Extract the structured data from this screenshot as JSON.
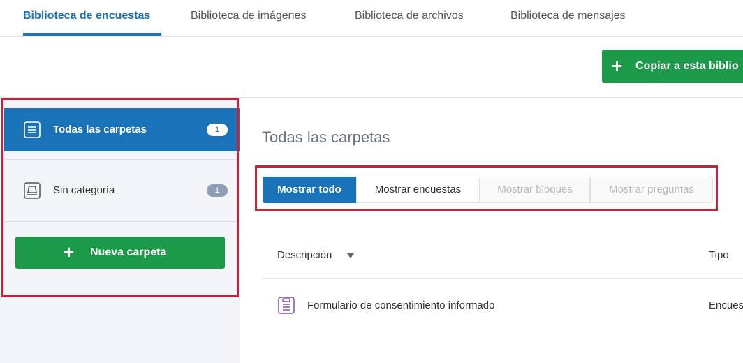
{
  "tabs": [
    {
      "label": "Biblioteca de encuestas",
      "active": true
    },
    {
      "label": "Biblioteca de imágenes",
      "active": false
    },
    {
      "label": "Biblioteca de archivos",
      "active": false
    },
    {
      "label": "Biblioteca de mensajes",
      "active": false
    }
  ],
  "toolbar": {
    "copy_label": "Copiar a esta biblio"
  },
  "sidebar": {
    "items": [
      {
        "label": "Todas las carpetas",
        "count": "1",
        "active": true,
        "icon": "folder-list-icon"
      },
      {
        "label": "Sin categoría",
        "count": "1",
        "active": false,
        "icon": "tray-icon"
      }
    ],
    "new_folder_label": "Nueva carpeta"
  },
  "main": {
    "title": "Todas las carpetas",
    "filters": [
      {
        "label": "Mostrar todo",
        "state": "active"
      },
      {
        "label": "Mostrar encuestas",
        "state": "enabled"
      },
      {
        "label": "Mostrar bloques",
        "state": "disabled"
      },
      {
        "label": "Mostrar preguntas",
        "state": "disabled"
      }
    ],
    "table": {
      "columns": [
        "Descripción",
        "Tipo"
      ],
      "rows": [
        {
          "description": "Formulario de consentimiento informado",
          "type": "Encues",
          "icon": "survey-clipboard-icon"
        }
      ]
    }
  },
  "colors": {
    "accent_blue": "#1a73b8",
    "green": "#1c9a4a",
    "highlight_red": "#c0263b",
    "icon_purple": "#7b4fa8"
  }
}
